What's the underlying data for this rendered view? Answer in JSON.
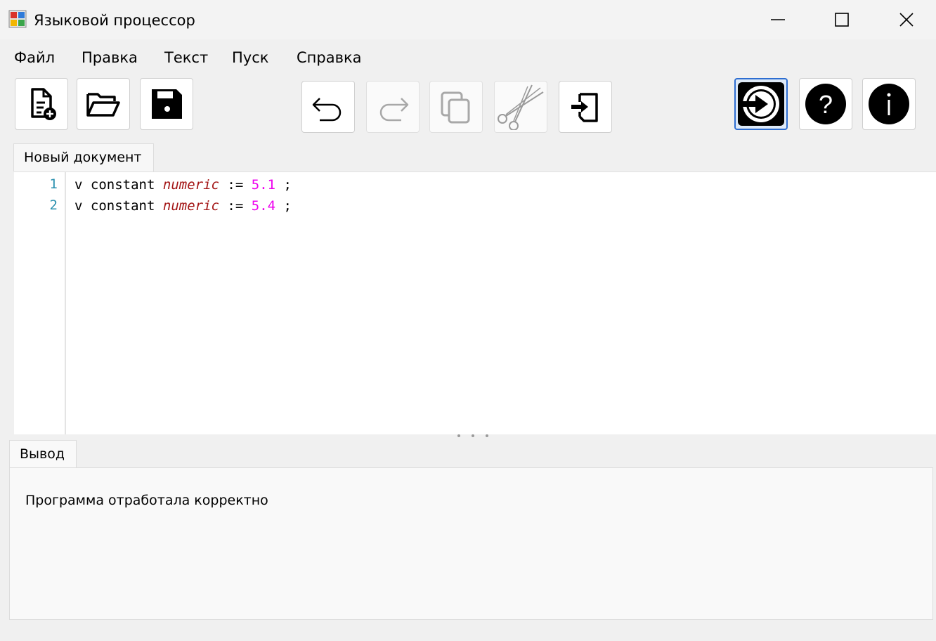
{
  "window": {
    "title": "Языковой процессор",
    "icons": {
      "app": "app-icon",
      "minimize": "minimize-icon",
      "maximize": "maximize-icon",
      "close": "close-icon"
    }
  },
  "menu": {
    "items": [
      {
        "label": "Файл"
      },
      {
        "label": "Правка"
      },
      {
        "label": "Текст"
      },
      {
        "label": "Пуск"
      },
      {
        "label": "Справка"
      }
    ]
  },
  "toolbar": {
    "buttons": [
      {
        "name": "new-document-button",
        "icon": "new-file-icon",
        "enabled": true
      },
      {
        "name": "open-file-button",
        "icon": "folder-open-icon",
        "enabled": true
      },
      {
        "name": "save-button",
        "icon": "save-icon",
        "enabled": true
      },
      {
        "name": "undo-button",
        "icon": "undo-icon",
        "enabled": true
      },
      {
        "name": "redo-button",
        "icon": "redo-icon",
        "enabled": false
      },
      {
        "name": "copy-button",
        "icon": "copy-icon",
        "enabled": false
      },
      {
        "name": "cut-button",
        "icon": "scissors-icon",
        "enabled": false
      },
      {
        "name": "paste-button",
        "icon": "paste-icon",
        "enabled": true
      },
      {
        "name": "run-button",
        "icon": "run-icon",
        "enabled": true,
        "active": true
      },
      {
        "name": "help-button",
        "icon": "help-icon",
        "enabled": true
      },
      {
        "name": "about-button",
        "icon": "info-icon",
        "enabled": true
      }
    ]
  },
  "editor": {
    "tab_label": "Новый документ",
    "lines": [
      {
        "number": "1",
        "ident": "v",
        "keyword": "constant",
        "type": "numeric",
        "op": ":=",
        "value": "5.1",
        "end": ";"
      },
      {
        "number": "2",
        "ident": "v",
        "keyword": "constant",
        "type": "numeric",
        "op": ":=",
        "value": "5.4",
        "end": ";"
      }
    ],
    "colors": {
      "line_number": "#2b91af",
      "type": "#a31515",
      "number": "#ee00ee"
    }
  },
  "output": {
    "tab_label": "Вывод",
    "message": "Программа отработала корректно"
  }
}
